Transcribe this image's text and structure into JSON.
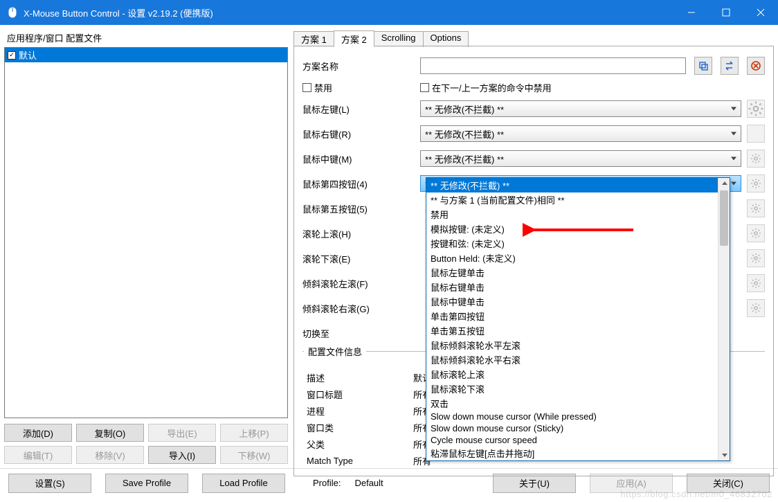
{
  "titlebar": {
    "title": "X-Mouse Button Control - 设置 v2.19.2 (便携版)"
  },
  "left": {
    "header": "应用程序/窗口 配置文件",
    "profiles": [
      {
        "label": "默认",
        "checked": true,
        "selected": true
      }
    ],
    "buttons": {
      "add": "添加(D)",
      "copy": "复制(O)",
      "export": "导出(E)",
      "moveup": "上移(P)",
      "edit": "编辑(T)",
      "remove": "移除(V)",
      "import": "导入(I)",
      "movedown": "下移(W)"
    }
  },
  "tabs": {
    "items": [
      "方案 1",
      "方案 2",
      "Scrolling",
      "Options"
    ],
    "active_index": 1
  },
  "form": {
    "name_label": "方案名称",
    "name_value": "",
    "disable_label": "禁用",
    "disable_next_label": "在下一/上一方案的命令中禁用",
    "no_change": "** 无修改(不拦截) **",
    "rows": [
      {
        "label": "鼠标左键(L)"
      },
      {
        "label": "鼠标右键(R)"
      },
      {
        "label": "鼠标中键(M)"
      },
      {
        "label": "鼠标第四按钮(4)",
        "highlight": true
      },
      {
        "label": "鼠标第五按钮(5)"
      },
      {
        "label": "滚轮上滚(H)"
      },
      {
        "label": "滚轮下滚(E)"
      },
      {
        "label": "倾斜滚轮左滚(F)"
      },
      {
        "label": "倾斜滚轮右滚(G)"
      },
      {
        "label": "切换至"
      }
    ]
  },
  "section_header": "配置文件信息",
  "info": {
    "rows": [
      {
        "label": "描述",
        "value": "默认"
      },
      {
        "label": "窗口标题",
        "value": "所有"
      },
      {
        "label": "进程",
        "value": "所有"
      },
      {
        "label": "窗口类",
        "value": "所有"
      },
      {
        "label": "父类",
        "value": "所有"
      },
      {
        "label": "Match Type",
        "value": "所有"
      }
    ]
  },
  "dropdown": {
    "options": [
      "** 无修改(不拦截) **",
      "** 与方案 1 (当前配置文件)相同 **",
      "禁用",
      "模拟按键: (未定义)",
      "按键和弦: (未定义)",
      "Button Held: (未定义)",
      "鼠标左键单击",
      "鼠标右键单击",
      "鼠标中键单击",
      "单击第四按钮",
      "单击第五按钮",
      "鼠标倾斜滚轮水平左滚",
      "鼠标倾斜滚轮水平右滚",
      "鼠标滚轮上滚",
      "鼠标滚轮下滚",
      "双击",
      "Slow down mouse cursor (While pressed)",
      "Slow down mouse cursor (Sticky)",
      "Cycle mouse cursor speed",
      "粘滞鼠标左键[点击并拖动]"
    ],
    "selected_index": 0
  },
  "footer": {
    "settings": "设置(S)",
    "save": "Save Profile",
    "load": "Load Profile",
    "profile_label": "Profile:",
    "profile_value": "Default",
    "about": "关于(U)",
    "apply": "应用(A)",
    "close": "关闭(C)"
  },
  "watermark": "https://blog.csdn.net/m0_46832702"
}
